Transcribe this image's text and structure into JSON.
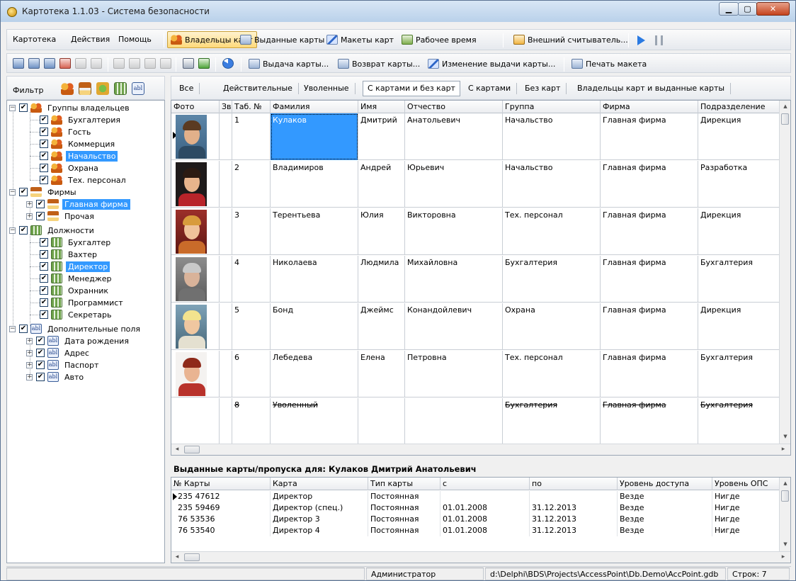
{
  "window": {
    "title": "Картотека 1.1.03 - Система безопасности"
  },
  "menu": {
    "items": [
      "Картотека",
      "Действия",
      "Помощь"
    ]
  },
  "toolbar": {
    "owners": "Владельцы карт",
    "issued": "Выданные карты",
    "layouts": "Макеты карт",
    "worktime": "Рабочее время",
    "reader": "Внешний считыватель..."
  },
  "actions": {
    "issue": "Выдача карты...",
    "return": "Возврат карты...",
    "change": "Изменение выдачи карты...",
    "print": "Печать макета"
  },
  "filter": {
    "label": "Фильтр"
  },
  "tabs": [
    "Все",
    "Действительные",
    "Уволенные",
    "С картами и без карт",
    "С картами",
    "Без карт",
    "Владельцы карт и выданные карты"
  ],
  "active_tab": "С картами и без карт",
  "tree": {
    "groups": {
      "label": "Группы владельцев",
      "children": [
        "Бухгалтерия",
        "Гость",
        "Коммерция",
        "Начальство",
        "Охрана",
        "Тех. персонал"
      ]
    },
    "firms": {
      "label": "Фирмы",
      "children": [
        "Главная фирма",
        "Прочая"
      ]
    },
    "positions": {
      "label": "Должности",
      "children": [
        "Бухгалтер",
        "Вахтер",
        "Директор",
        "Менеджер",
        "Охранник",
        "Программист",
        "Секретарь"
      ]
    },
    "extra": {
      "label": "Дополнительные поля",
      "children": [
        "Дата рождения",
        "Адрес",
        "Паспорт",
        "Авто"
      ]
    },
    "selected": [
      "Начальство",
      "Главная фирма",
      "Директор"
    ]
  },
  "owners_table": {
    "columns": [
      "Фото",
      "Зв",
      "Таб. №",
      "Фамилия",
      "Имя",
      "Отчество",
      "Группа",
      "Фирма",
      "Подразделение"
    ],
    "rows": [
      {
        "tab": "1",
        "surname": "Кулаков",
        "name": "Дмитрий",
        "patronymic": "Анатольевич",
        "group": "Начальство",
        "firm": "Главная фирма",
        "dept": "Дирекция"
      },
      {
        "tab": "2",
        "surname": "Владимиров",
        "name": "Андрей",
        "patronymic": "Юрьевич",
        "group": "Начальство",
        "firm": "Главная фирма",
        "dept": "Разработка"
      },
      {
        "tab": "3",
        "surname": "Терентьева",
        "name": "Юлия",
        "patronymic": "Викторовна",
        "group": "Тех. персонал",
        "firm": "Главная фирма",
        "dept": "Дирекция"
      },
      {
        "tab": "4",
        "surname": "Николаева",
        "name": "Людмила",
        "patronymic": "Михайловна",
        "group": "Бухгалтерия",
        "firm": "Главная фирма",
        "dept": "Бухгалтерия"
      },
      {
        "tab": "5",
        "surname": "Бонд",
        "name": "Джеймс",
        "patronymic": "Конандойлевич",
        "group": "Охрана",
        "firm": "Главная фирма",
        "dept": "Дирекция"
      },
      {
        "tab": "6",
        "surname": "Лебедева",
        "name": "Елена",
        "patronymic": "Петровна",
        "group": "Тех. персонал",
        "firm": "Главная фирма",
        "dept": "Бухгалтерия"
      },
      {
        "tab": "8",
        "surname": "Уволенный",
        "name": "",
        "patronymic": "",
        "group": "Бухгалтерия",
        "firm": "Главная фирма",
        "dept": "Бухгалтерия"
      }
    ]
  },
  "cards_section": {
    "title": "Выданные карты/пропуска для: Кулаков Дмитрий Анатольевич",
    "columns": [
      "№ Карты",
      "Карта",
      "Тип карты",
      "с",
      "по",
      "Уровень доступа",
      "Уровень ОПС"
    ],
    "rows": [
      {
        "num": "235 47612",
        "card": "Директор",
        "type": "Постоянная",
        "from": "",
        "to": "",
        "access": "Везде",
        "ops": "Нигде"
      },
      {
        "num": "235 59469",
        "card": "Директор (спец.)",
        "type": "Постоянная",
        "from": "01.01.2008",
        "to": "31.12.2013",
        "access": "Везде",
        "ops": "Нигде"
      },
      {
        "num": "76 53536",
        "card": "Директор 3",
        "type": "Постоянная",
        "from": "01.01.2008",
        "to": "31.12.2013",
        "access": "Везде",
        "ops": "Нигде"
      },
      {
        "num": "76 53540",
        "card": "Директор 4",
        "type": "Постоянная",
        "from": "01.01.2008",
        "to": "31.12.2013",
        "access": "Везде",
        "ops": "Нигде"
      }
    ]
  },
  "status": {
    "user": "Администратор",
    "db_path": "d:\\Delphi\\BDS\\Projects\\AccessPoint\\Db.Demo\\AccPoint.gdb",
    "rows": "Строк: 7"
  }
}
